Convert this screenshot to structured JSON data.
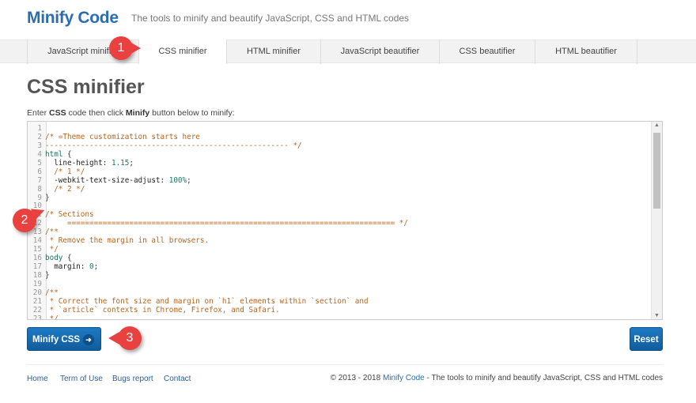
{
  "header": {
    "brand": "Minify Code",
    "tagline": "The tools to minify and beautify JavaScript, CSS and HTML codes"
  },
  "tabs": [
    {
      "label": "JavaScript minifier",
      "active": false
    },
    {
      "label": "CSS minifier",
      "active": true
    },
    {
      "label": "HTML minifier",
      "active": false
    },
    {
      "label": "JavaScript beautifier",
      "active": false
    },
    {
      "label": "CSS beautifier",
      "active": false
    },
    {
      "label": "HTML beautifier",
      "active": false
    }
  ],
  "page": {
    "title": "CSS minifier",
    "instr_pre": "Enter ",
    "instr_b1": "CSS",
    "instr_mid": " code then click ",
    "instr_b2": "Minify",
    "instr_post": " button below to minify:"
  },
  "editor": {
    "lines": [
      [],
      [
        [
          "comment",
          "/* =Theme customization starts here"
        ]
      ],
      [
        [
          "comment",
          "------------------------------------------------------- */"
        ]
      ],
      [
        [
          "sel",
          "html"
        ],
        [
          "punc",
          " {"
        ]
      ],
      [
        [
          "prop",
          "  line-height: "
        ],
        [
          "num",
          "1.15"
        ],
        [
          "punc",
          ";"
        ]
      ],
      [
        [
          "comment",
          "  /* 1 */"
        ]
      ],
      [
        [
          "prop",
          "  -webkit-text-size-adjust: "
        ],
        [
          "num",
          "100%"
        ],
        [
          "punc",
          ";"
        ]
      ],
      [
        [
          "comment",
          "  /* 2 */"
        ]
      ],
      [
        [
          "punc",
          "}"
        ]
      ],
      [],
      [
        [
          "comment",
          "/* Sections"
        ]
      ],
      [
        [
          "comment",
          "     ========================================================================== */"
        ]
      ],
      [
        [
          "comment",
          "/**"
        ]
      ],
      [
        [
          "comment",
          " * Remove the margin in all browsers."
        ]
      ],
      [
        [
          "comment",
          " */"
        ]
      ],
      [
        [
          "sel",
          "body"
        ],
        [
          "punc",
          " {"
        ]
      ],
      [
        [
          "prop",
          "  margin: "
        ],
        [
          "num",
          "0"
        ],
        [
          "punc",
          ";"
        ]
      ],
      [
        [
          "punc",
          "}"
        ]
      ],
      [],
      [
        [
          "comment",
          "/**"
        ]
      ],
      [
        [
          "comment",
          " * Correct the font size and margin on `h1` elements within `section` and"
        ]
      ],
      [
        [
          "comment",
          " * `article` contexts in Chrome, Firefox, and Safari."
        ]
      ],
      [
        [
          "comment",
          " */"
        ]
      ]
    ]
  },
  "buttons": {
    "minify": "Minify CSS",
    "minify_icon": "arrow-right-icon",
    "reset": "Reset"
  },
  "footer": {
    "links": [
      "Home",
      "Term of Use",
      "Bugs report",
      "Contact"
    ],
    "copy_pre": "© 2013 - 2018 ",
    "copy_link": "Minify Code",
    "copy_post": " - The tools to minify and beautify JavaScript, CSS and HTML codes"
  },
  "annotations": [
    "1",
    "2",
    "3"
  ],
  "colors": {
    "brand": "#2a6db0",
    "button": "#1767a8",
    "marker": "#e8413f"
  }
}
